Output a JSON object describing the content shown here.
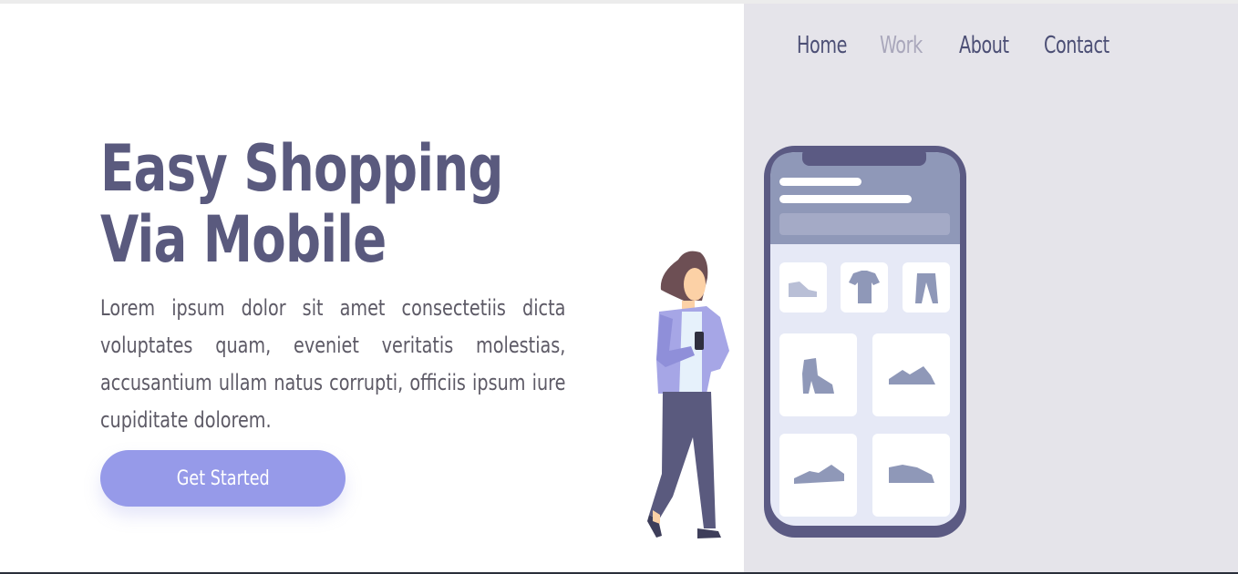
{
  "nav": {
    "items": [
      {
        "label": "Home",
        "active": false
      },
      {
        "label": "Work",
        "active": true
      },
      {
        "label": "About",
        "active": false
      },
      {
        "label": "Contact",
        "active": false
      }
    ]
  },
  "hero": {
    "title_line1": "Easy Shopping",
    "title_line2": "Via Mobile",
    "body": "Lorem ipsum dolor sit amet consectetiis dicta voluptates quam, eveniet veritatis molestias, accusantium ullam natus corrupti, officiis ipsum iure cupiditate dolorem.",
    "cta_label": "Get Started"
  },
  "colors": {
    "accent": "#969ae9",
    "title": "#5a5a7e",
    "panel": "#e5e4ea",
    "nav_active": "#a9a7bb"
  },
  "illustration": {
    "icons": [
      "sneaker-icon",
      "tshirt-icon",
      "pants-icon",
      "boot-icon",
      "shoe-icon",
      "flat-shoe-icon",
      "running-shoe-icon"
    ]
  }
}
